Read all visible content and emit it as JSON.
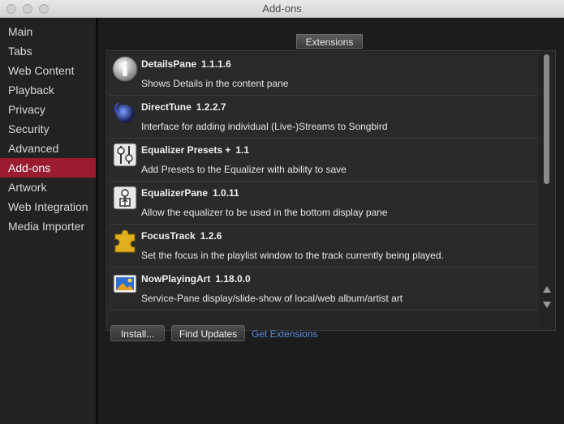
{
  "window": {
    "title": "Add-ons"
  },
  "sidebar": {
    "items": [
      {
        "label": "Main"
      },
      {
        "label": "Tabs"
      },
      {
        "label": "Web Content"
      },
      {
        "label": "Playback"
      },
      {
        "label": "Privacy"
      },
      {
        "label": "Security"
      },
      {
        "label": "Advanced"
      },
      {
        "label": "Add-ons",
        "active": true
      },
      {
        "label": "Artwork"
      },
      {
        "label": "Web Integration"
      },
      {
        "label": "Media Importer"
      }
    ]
  },
  "main": {
    "tab_label": "Extensions",
    "extensions": [
      {
        "name": "DetailsPane",
        "version": "1.1.1.6",
        "description": "Shows Details in the content pane",
        "icon": "info-icon"
      },
      {
        "name": "DirectTune",
        "version": "1.2.2.7",
        "description": "Interface for adding individual (Live-)Streams to Songbird",
        "icon": "stream-icon"
      },
      {
        "name": "Equalizer Presets +",
        "version": "1.1",
        "description": "Add Presets to the Equalizer with ability to save",
        "icon": "equalizer-icon"
      },
      {
        "name": "EqualizerPane",
        "version": "1.0.11",
        "description": "Allow the equalizer to be used in the bottom display pane",
        "icon": "equalizer-pane-icon"
      },
      {
        "name": "FocusTrack",
        "version": "1.2.6",
        "description": "Set the focus in the playlist window to the track currently being played.",
        "icon": "puzzle-icon"
      },
      {
        "name": "NowPlayingArt",
        "version": "1.18.0.0",
        "description": "Service-Pane display/slide-show of local/web album/artist art",
        "icon": "picture-icon"
      }
    ],
    "buttons": {
      "install": "Install...",
      "find_updates": "Find Updates",
      "get_extensions": "Get Extensions"
    }
  },
  "colors": {
    "active_sidebar": "#9b1b30",
    "link": "#5b8de0"
  }
}
